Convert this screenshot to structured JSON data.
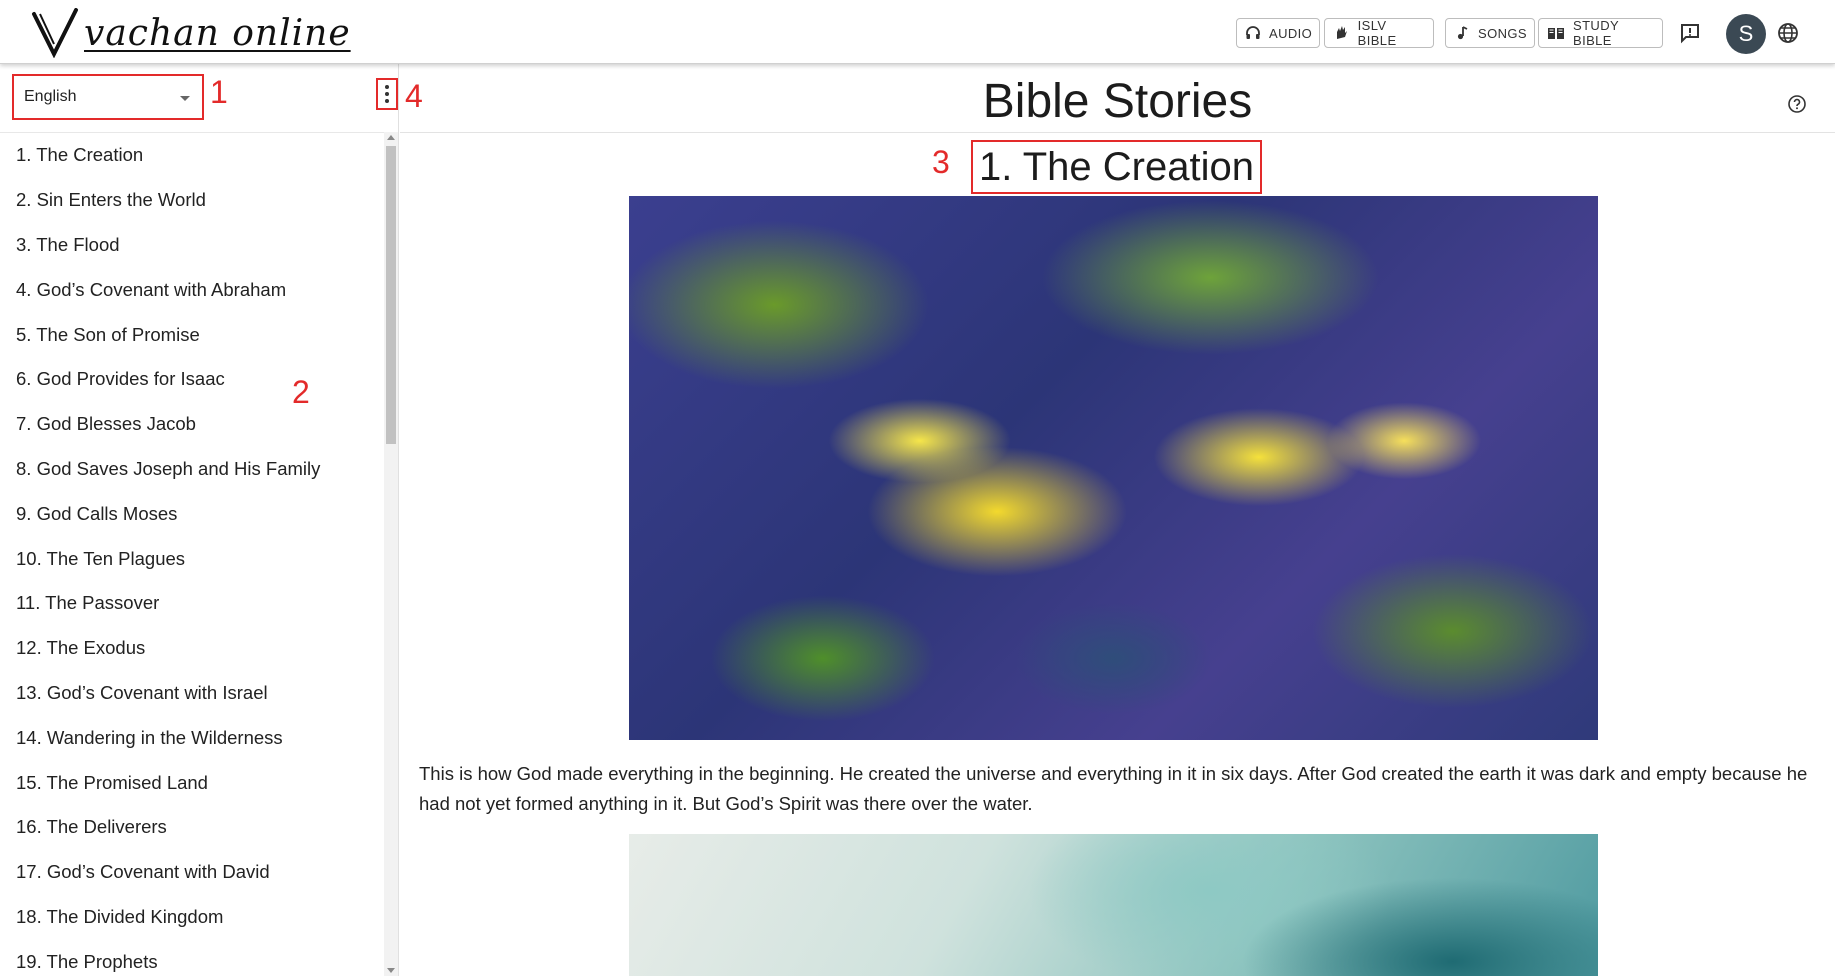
{
  "header": {
    "logo_text": "vachan online",
    "buttons": {
      "audio": "AUDIO",
      "islv": "ISLV BIBLE",
      "songs": "SONGS",
      "study": "STUDY BIBLE"
    },
    "avatar_initial": "S",
    "icons": [
      "headphones-icon",
      "sign-language-icon",
      "music-note-icon",
      "book-icon",
      "feedback-icon",
      "globe-icon"
    ]
  },
  "sidebar": {
    "language": "English",
    "stories": [
      "1. The Creation",
      "2. Sin Enters the World",
      "3. The Flood",
      "4. God’s Covenant with Abraham",
      "5. The Son of Promise",
      "6. God Provides for Isaac",
      "7. God Blesses Jacob",
      "8. God Saves Joseph and His Family",
      "9. God Calls Moses",
      "10. The Ten Plagues",
      "11. The Passover",
      "12. The Exodus",
      "13. God’s Covenant with Israel",
      "14. Wandering in the Wilderness",
      "15. The Promised Land",
      "16. The Deliverers",
      "17. God’s Covenant with David",
      "18. The Divided Kingdom",
      "19. The Prophets"
    ]
  },
  "annotations": {
    "a1": "1",
    "a2": "2",
    "a3": "3",
    "a4": "4"
  },
  "main": {
    "page_title": "Bible Stories",
    "story_title": "1. The Creation",
    "paragraph": "This is how God made everything in the beginning. He created the universe and everything in it in six days. After God created the earth it was dark and empty because he had not yet formed anything in it. But God’s Spirit was there over the water."
  },
  "colors": {
    "annotation": "#e32a2a",
    "avatar_bg": "#3b4954"
  }
}
